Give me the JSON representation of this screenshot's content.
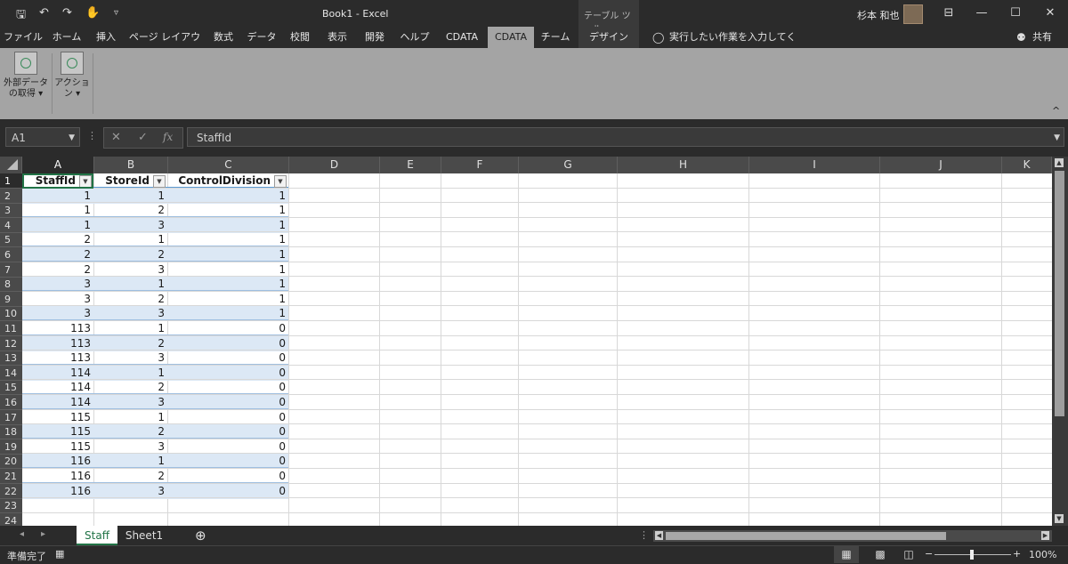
{
  "window": {
    "title": "Book1  -  Excel",
    "context_tool": "テーブル ツール",
    "user": "杉本 和也",
    "controls": {
      "restore": "⊟",
      "minimize": "—",
      "maximize": "☐",
      "close": "✕"
    }
  },
  "quick_access": {
    "save_icon": "💾",
    "undo": "↶",
    "redo": "↷",
    "touch": "✋",
    "more": "▿"
  },
  "tabs": [
    {
      "label": "ファイル"
    },
    {
      "label": "ホーム"
    },
    {
      "label": "挿入"
    },
    {
      "label": "ページ レイアウト"
    },
    {
      "label": "数式"
    },
    {
      "label": "データ"
    },
    {
      "label": "校閲"
    },
    {
      "label": "表示"
    },
    {
      "label": "開発"
    },
    {
      "label": "ヘルプ"
    },
    {
      "label": "CDATA"
    },
    {
      "label": "CDATA"
    },
    {
      "label": "チーム"
    },
    {
      "label": "デザイン"
    }
  ],
  "tell_me": "実行したい作業を入力してください",
  "share": "共有",
  "ribbon": {
    "buttons": [
      {
        "line1": "外部データ",
        "line2": "の取得 ▾"
      },
      {
        "line1": "アクショ",
        "line2": "ン ▾"
      }
    ],
    "collapse": "^"
  },
  "formula_bar": {
    "name_box": "A1",
    "cancel": "✕",
    "enter": "✓",
    "fx": "fx",
    "content": "StaffId"
  },
  "columns": [
    "A",
    "B",
    "C",
    "D",
    "E",
    "F",
    "G",
    "H",
    "I",
    "J",
    "K"
  ],
  "row_numbers": [
    "1",
    "2",
    "3",
    "4",
    "5",
    "6",
    "7",
    "8",
    "9",
    "10",
    "11",
    "12",
    "13",
    "14",
    "15",
    "16",
    "17",
    "18",
    "19",
    "20",
    "21",
    "22",
    "23",
    "24"
  ],
  "table": {
    "headers": [
      "StaffId",
      "StoreId",
      "ControlDivision"
    ],
    "rows": [
      [
        "1",
        "1",
        "1"
      ],
      [
        "1",
        "2",
        "1"
      ],
      [
        "1",
        "3",
        "1"
      ],
      [
        "2",
        "1",
        "1"
      ],
      [
        "2",
        "2",
        "1"
      ],
      [
        "2",
        "3",
        "1"
      ],
      [
        "3",
        "1",
        "1"
      ],
      [
        "3",
        "2",
        "1"
      ],
      [
        "3",
        "3",
        "1"
      ],
      [
        "113",
        "1",
        "0"
      ],
      [
        "113",
        "2",
        "0"
      ],
      [
        "113",
        "3",
        "0"
      ],
      [
        "114",
        "1",
        "0"
      ],
      [
        "114",
        "2",
        "0"
      ],
      [
        "114",
        "3",
        "0"
      ],
      [
        "115",
        "1",
        "0"
      ],
      [
        "115",
        "2",
        "0"
      ],
      [
        "115",
        "3",
        "0"
      ],
      [
        "116",
        "1",
        "0"
      ],
      [
        "116",
        "2",
        "0"
      ],
      [
        "116",
        "3",
        "0"
      ]
    ]
  },
  "sheets": {
    "nav_prev": "◂",
    "nav_next": "▸",
    "tabs": [
      "Staff",
      "Sheet1"
    ],
    "active": "Staff",
    "add": "⊕"
  },
  "status": {
    "ready": "準備完了",
    "zoom": "100%",
    "minus": "−",
    "plus": "+"
  }
}
